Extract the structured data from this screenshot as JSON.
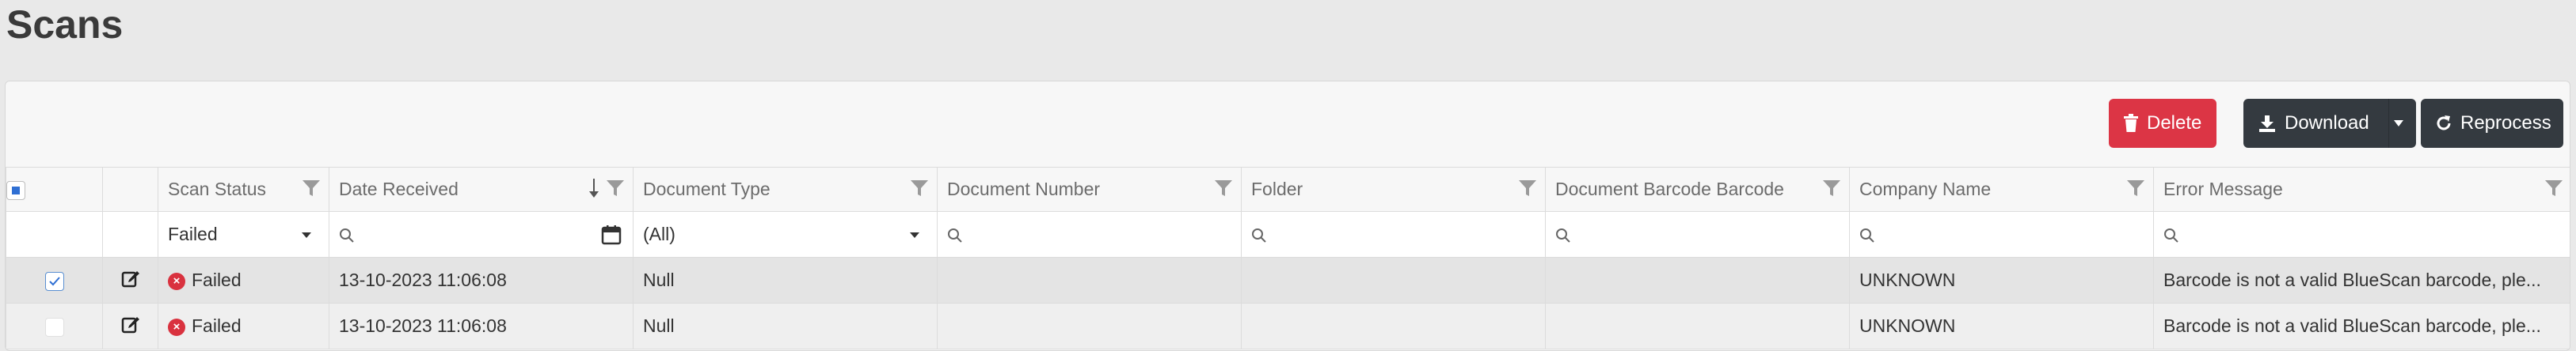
{
  "page": {
    "title": "Scans"
  },
  "toolbar": {
    "delete_label": "Delete",
    "download_label": "Download",
    "reprocess_label": "Reprocess"
  },
  "colors": {
    "delete": "#dc3545",
    "dark_button": "#343a40",
    "error": "#d9323f",
    "select_blue": "#2f6fd3"
  },
  "columns": [
    {
      "key": "select",
      "label": ""
    },
    {
      "key": "edit",
      "label": ""
    },
    {
      "key": "scan_status",
      "label": "Scan Status"
    },
    {
      "key": "date_received",
      "label": "Date Received"
    },
    {
      "key": "document_type",
      "label": "Document Type"
    },
    {
      "key": "document_number",
      "label": "Document Number"
    },
    {
      "key": "folder",
      "label": "Folder"
    },
    {
      "key": "document_barcode",
      "label": "Document Barcode Barcode"
    },
    {
      "key": "company_name",
      "label": "Company Name"
    },
    {
      "key": "error_message",
      "label": "Error Message"
    }
  ],
  "filters": {
    "scan_status": "Failed",
    "document_type": "(All)"
  },
  "rows": [
    {
      "selected": true,
      "scan_status": "Failed",
      "date_received": "13-10-2023 11:06:08",
      "document_type": "Null",
      "document_number": "",
      "folder": "",
      "document_barcode": "",
      "company_name": "UNKNOWN",
      "error_message": "Barcode is not a valid BlueScan barcode, ple..."
    },
    {
      "selected": false,
      "scan_status": "Failed",
      "date_received": "13-10-2023 11:06:08",
      "document_type": "Null",
      "document_number": "",
      "folder": "",
      "document_barcode": "",
      "company_name": "UNKNOWN",
      "error_message": "Barcode is not a valid BlueScan barcode, ple..."
    }
  ]
}
